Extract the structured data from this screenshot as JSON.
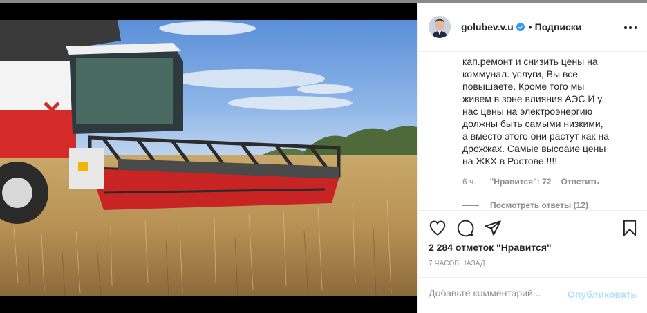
{
  "post": {
    "image_icon": "combine-harvester-photo"
  },
  "header": {
    "username": "golubev.v.u",
    "verified_icon": "verified-badge-icon",
    "separator": "•",
    "follow_state": "Подписки",
    "more_icon": "more-options-icon"
  },
  "comment": {
    "lines": [
      "кап.ремонт и снизить цены на",
      "коммунал. услуги, Вы все",
      "повышаете. Кроме того мы",
      "живем в зоне влияния АЭС И у",
      "нас цены на электроэнергию",
      "должны быть самыми низкими,",
      "а вместо этого они растут как на",
      "дрожжах. Самые высоаие цены",
      "на ЖКХ в Ростове.!!!!"
    ],
    "time": "6 ч.",
    "likes": "\"Нравится\": 72",
    "reply": "Ответить",
    "view_replies": "Посмотреть ответы (12)"
  },
  "actions": {
    "like_icon": "heart-icon",
    "comment_icon": "comment-bubble-icon",
    "share_icon": "paper-plane-icon",
    "save_icon": "bookmark-icon"
  },
  "likes_count": "2 284 отметок \"Нравится\"",
  "post_time": "7 ЧАСОВ НАЗАД",
  "add_comment": {
    "placeholder": "Добавьте комментарий...",
    "publish": "Опубликовать"
  },
  "colors": {
    "accent_disabled": "#b2dffc",
    "verified": "#3897f0",
    "text": "#262626",
    "muted": "#8e8e8e"
  }
}
